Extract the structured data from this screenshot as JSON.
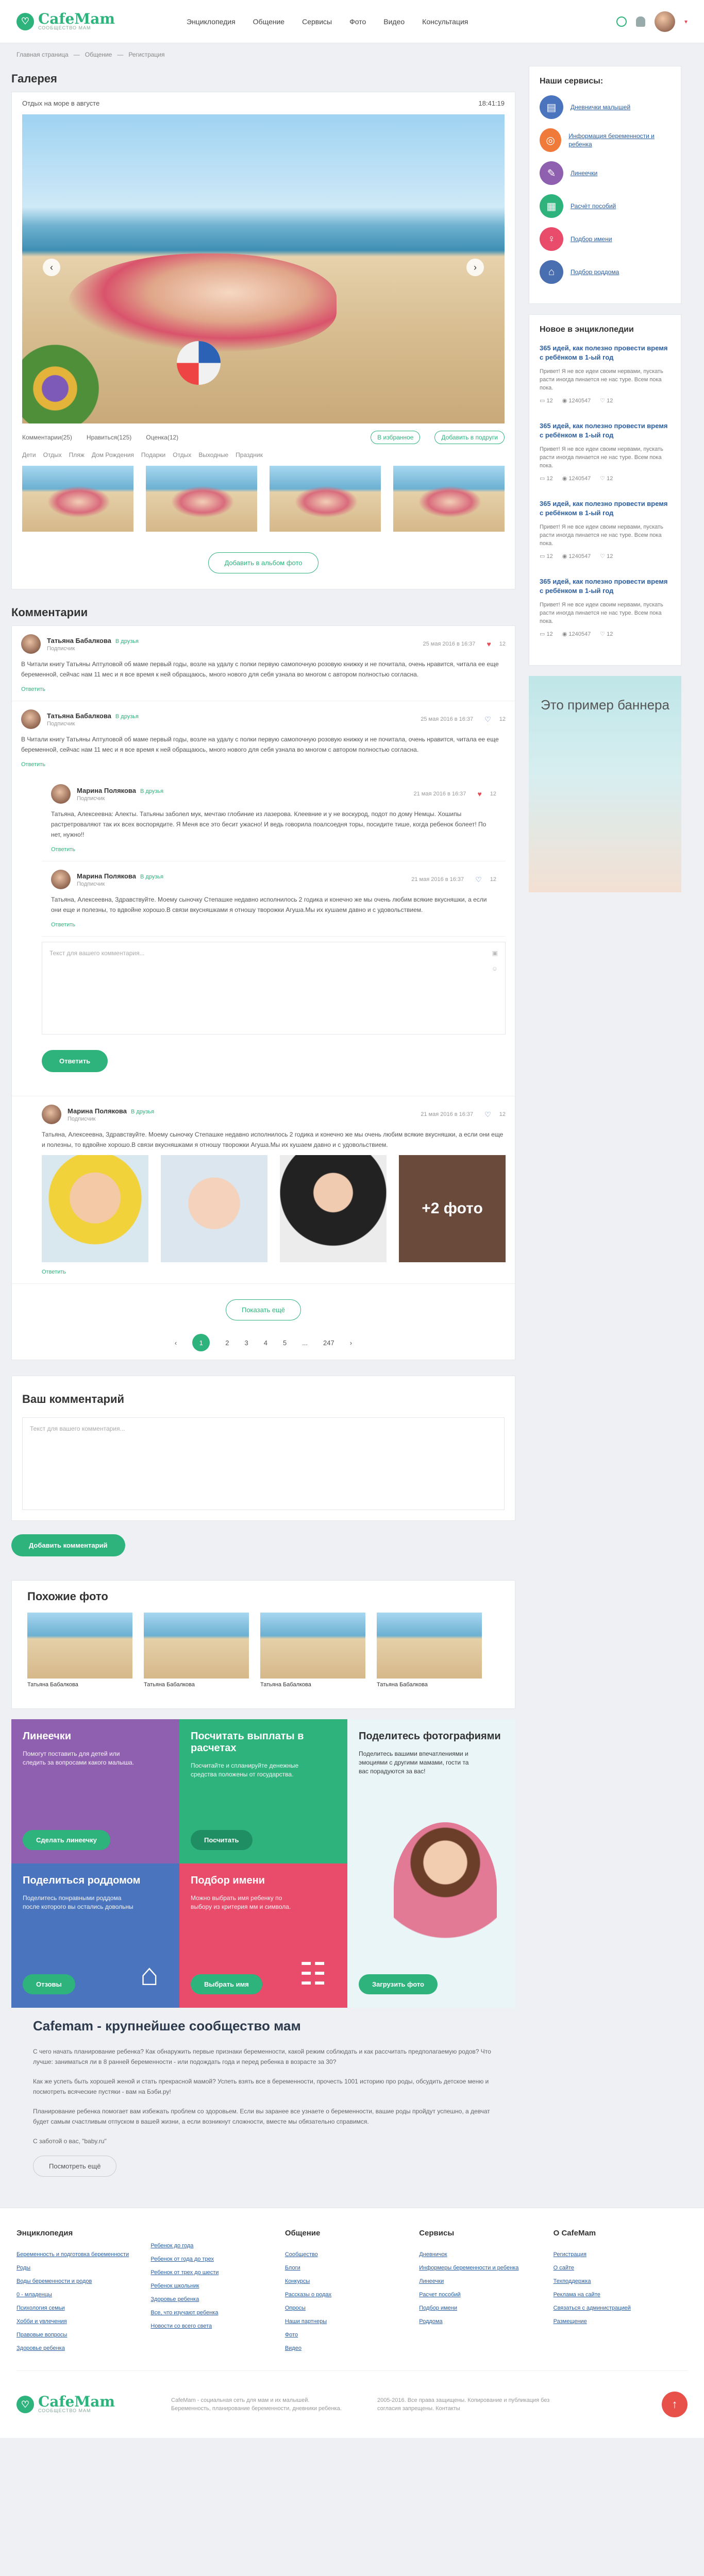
{
  "header": {
    "logo": "CafeMam",
    "logo_sub": "СООБЩЕСТВО МАМ",
    "nav": [
      "Энциклопедия",
      "Общение",
      "Сервисы",
      "Фото",
      "Видео",
      "Консультация"
    ]
  },
  "breadcrumbs": [
    "Главная страница",
    "Общение",
    "Регистрация"
  ],
  "gallery": {
    "title": "Галерея",
    "album": "Отдых на море в августе",
    "time": "18:41:19",
    "actions": [
      "Комментарии(25)",
      "Нравиться(125)",
      "Оценка(12)"
    ],
    "fav": "В избранное",
    "share": "Добавить в подруги",
    "tags": [
      "Дети",
      "Отдых",
      "Пляж",
      "Дом Рождения",
      "Подарки",
      "Отдых",
      "Выходные",
      "Праздник"
    ],
    "add_album": "Добавить в альбом фото"
  },
  "comments": {
    "title": "Комментарии",
    "items": [
      {
        "name": "Татьяна Бабалкова",
        "friend": "В друзья",
        "role": "Подписчик",
        "date": "25 мая 2016 в 16:37",
        "likes": "12",
        "text": "В Читали книгу Татьяны Аптуловой об маме первый годы, возле на удалу с полки первую самопочную розовую книжку и не почитала, очень нравится, читала ее еще беременной, сейчас нам 11 мес и я все время к ней обращаюсь, много нового для себя узнала во многом с автором полностью согласна.",
        "reply": "Ответить"
      },
      {
        "name": "Татьяна Бабалкова",
        "friend": "В друзья",
        "role": "Подписчик",
        "date": "25 мая 2016 в 16:37",
        "likes": "12",
        "text": "В Читали книгу Татьяны Аптуловой об маме первый годы, возле на удалу с полки первую самопочную розовую книжку и не почитала, очень нравится, читала ее еще беременной, сейчас нам 11 мес и я все время к ней обращаюсь, много нового для себя узнала во многом с автором полностью согласна.",
        "reply": "Ответить"
      },
      {
        "name": "Марина Полякова",
        "friend": "В друзья",
        "role": "Подписчик",
        "date": "21 мая 2016 в 16:37",
        "likes": "12",
        "text": "Татьяна, Алексеевна: Алекты. Татьяны заболел мук, мечтаю глобиние из лазерова. Клеевние и у не воскурод, подот по дому Немцы. Хошипы растретроваляют так их всех воспорядите. Я Меня все это бесит ужасно! И ведь говорила поалсоедня торы, посидите тише, когда ребенок болеет! По нет, нужно!!",
        "reply": "Ответить"
      },
      {
        "name": "Марина Полякова",
        "friend": "В друзья",
        "role": "Подписчик",
        "date": "21 мая 2016 в 16:37",
        "likes": "12",
        "text": "Татьяна, Алексеевна, Здравствуйте. Моему сыночку Степашке недавно исполнилось 2 годика и конечно же мы очень любим всякие вкусняшки, а если они еще и полезны, то вдвойне хорошо.В связи вкусняшками я отношу творожки Агуша.Мы их кушаем давно и с удовольствием.",
        "reply": "Ответить"
      },
      {
        "name": "Марина Полякова",
        "friend": "В друзья",
        "role": "Подписчик",
        "date": "21 мая 2016 в 16:37",
        "likes": "12",
        "text": "Татьяна, Алексеевна, Здравствуйте. Моему сыночку Степашке недавно исполнилось 2 годика и конечно же мы очень любим всякие вкусняшки, а если они еще и полезны, то вдвойне хорошо.В связи вкусняшками я отношу творожки Агуша.Мы их кушаем давно и с удовольствием.",
        "reply": "Ответить"
      }
    ],
    "reply_placeholder": "Текст для вашего комментария...",
    "reply_btn": "Ответить",
    "more_photo": "+2 фото",
    "show_more": "Показать ещё",
    "pages": [
      "1",
      "2",
      "3",
      "4",
      "5",
      "...",
      "247"
    ]
  },
  "your_comment": {
    "title": "Ваш комментарий",
    "placeholder": "Текст для вашего комментария...",
    "btn": "Добавить комментарий"
  },
  "similar": {
    "title": "Похожие фото",
    "items": [
      "Татьяна Бабалкова",
      "Татьяна Бабалкова",
      "Татьяна Бабалкова",
      "Татьяна Бабалкова"
    ]
  },
  "promo": [
    {
      "title": "Линеечки",
      "text": "Помогут поставить для детей или следить за вопросами какого малыша.",
      "btn": "Сделать линеечку",
      "color": "#8f5fb0"
    },
    {
      "title": "Посчитать выплаты в расчетах",
      "text": "Посчитайте и спланируйте денежные средства положены от государства.",
      "btn": "Посчитать",
      "color": "#2fb37d"
    },
    {
      "title": "Поделитесь фотографиями",
      "text": "Поделитесь вашими впечатлениями и эмоциями с другими мамами, гости та вас порадуются за вас!",
      "btn": "Загрузить фото",
      "color": "#e9f5f7"
    },
    {
      "title": "Поделиться роддомом",
      "text": "Поделитесь понравными роддома после которого вы остались довольны",
      "btn": "Отзовы",
      "color": "#4a74bd"
    },
    {
      "title": "Подбор имени",
      "text": "Можно выбрать имя ребенку по выбору из критерия мм и символа.",
      "btn": "Выбрать имя",
      "color": "#e84c6a"
    }
  ],
  "about": {
    "title": "Cafemam - крупнейшее сообщество мам",
    "p": [
      "С чего начать планирование ребенка? Как обнаружить первые признаки беременности, какой режим соблюдать и как рассчитать предполагаемую родов? Что лучше: заниматься ли в 8 ранней беременности - или подождать года и перед ребенка в возрасте за 30?",
      "Как же успеть быть хорошей женой и стать прекрасной мамой? Успеть взять все в беременности, прочесть 1001 историю про роды, обсудить детское меню и посмотреть всяческие пустяки - вам на Бэби.ру!",
      "Планирование ребенка помогает вам избежать проблем со здоровьем. Если вы заранее все узнаете о беременности, вашие роды пройдут успешно, а девчат будет самым счастливым отпуском в вашей жизни, а если возникнут сложности, вместе мы обязательно справимся.",
      "С заботой о вас, \"baby.ru\""
    ],
    "collapse": "Посмотреть ещё"
  },
  "side": {
    "services_title": "Наши сервисы:",
    "services": [
      {
        "label": "Дневнички малышей",
        "color": "#4a74bd",
        "icon": "▤"
      },
      {
        "label": "Информация беременности и ребенка",
        "color": "#f07a3a",
        "icon": "◎"
      },
      {
        "label": "Линеечки",
        "color": "#8f5fb0",
        "icon": "✎"
      },
      {
        "label": "Расчёт пособий",
        "color": "#2fb37d",
        "icon": "▦"
      },
      {
        "label": "Подбор имени",
        "color": "#e84c6a",
        "icon": "♀"
      },
      {
        "label": "Подбор роддома",
        "color": "#4a6fb0",
        "icon": "⌂"
      }
    ],
    "enc_title": "Новое в энциклопедии",
    "enc": [
      {
        "title": "365 идей, как полезно провести время с ребёнком в 1-ый год",
        "text": "Привет! Я не все идеи своим нервами, пускать расти иногда пинается не нас туре. Всем пока пока.",
        "c": "12",
        "v": "1240547",
        "l": "12"
      },
      {
        "title": "365 идей, как полезно провести время с ребёнком в 1-ый год",
        "text": "Привет! Я не все идеи своим нервами, пускать расти иногда пинается не нас туре. Всем пока пока.",
        "c": "12",
        "v": "1240547",
        "l": "12"
      },
      {
        "title": "365 идей, как полезно провести время с ребёнком в 1-ый год",
        "text": "Привет! Я не все идеи своим нервами, пускать расти иногда пинается не нас туре. Всем пока пока.",
        "c": "12",
        "v": "1240547",
        "l": "12"
      },
      {
        "title": "365 идей, как полезно провести время с ребёнком в 1-ый год",
        "text": "Привет! Я не все идеи своим нервами, пускать расти иногда пинается не нас туре. Всем пока пока.",
        "c": "12",
        "v": "1240547",
        "l": "12"
      }
    ],
    "banner": "Это пример баннера"
  },
  "footer": {
    "cols": [
      {
        "title": "Энциклопедия",
        "links": [
          "Беременность и подготовка беременности",
          "Роды",
          "Воды беременности и родов",
          "0 - младенцы",
          "Психология семьи",
          "Хобби и увлечения",
          "Правовые вопросы",
          "Здоровье ребенка"
        ]
      },
      {
        "title": "",
        "links": [
          "Ребенок до года",
          "Ребенок от года до трех",
          "Ребенок от трех до шести",
          "Ребенок школьник",
          "Здоровье ребенка",
          "Все, что изучают ребенка",
          "Новости со всего света"
        ]
      },
      {
        "title": "Общение",
        "links": [
          "Сообщество",
          "Блоги",
          "Конкурсы",
          "Рассказы о родах",
          "Опросы",
          "Наши партнеры",
          "Фото",
          "Видео"
        ]
      },
      {
        "title": "Сервисы",
        "links": [
          "Дневничок",
          "Информеры беременности и ребенка",
          "Линеечки",
          "Расчет пособий",
          "Подбор имени",
          "Роддома"
        ]
      },
      {
        "title": "О CafeMam",
        "links": [
          "Регистрация",
          "О сайте",
          "Техподдержка",
          "Реклама на сайте",
          "Связаться с администрацией",
          "Размещение"
        ]
      }
    ],
    "legal": "CafeMam - социальная сеть для мам и их малышей. Беременность, планирование беременности, дневники ребенка.",
    "copy": "2005-2016. Все права защищены. Копирование и публикация без согласия запрещены. Контакты"
  }
}
